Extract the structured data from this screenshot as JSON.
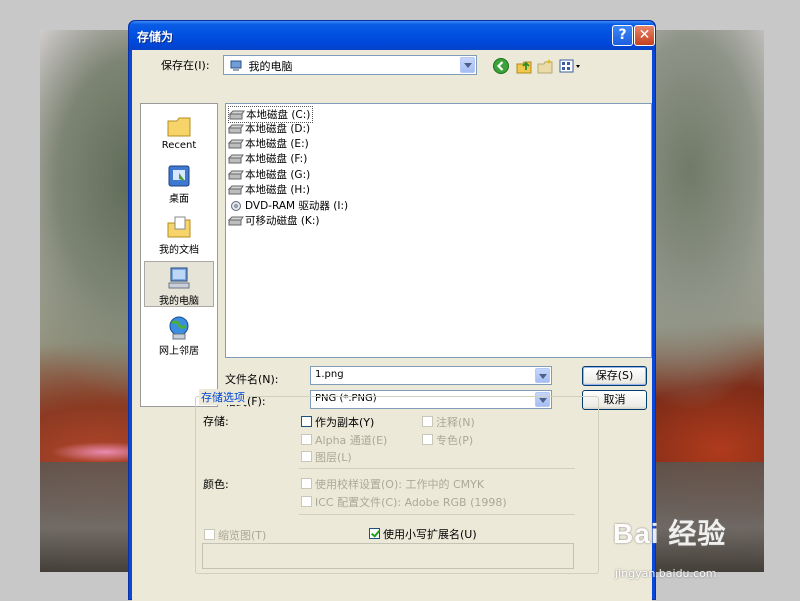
{
  "dialog": {
    "title": "存储为",
    "help_glyph": "?",
    "close_glyph": "✕"
  },
  "save_in": {
    "label": "保存在(I):",
    "value": "我的电脑"
  },
  "places": [
    {
      "label": "Recent",
      "icon": "recent-folder-icon"
    },
    {
      "label": "桌面",
      "icon": "desktop-icon"
    },
    {
      "label": "我的文档",
      "icon": "my-documents-icon"
    },
    {
      "label": "我的电脑",
      "icon": "my-computer-icon",
      "selected": true
    },
    {
      "label": "网上邻居",
      "icon": "network-places-icon"
    }
  ],
  "drives": [
    {
      "label": "本地磁盘 (C:)",
      "icon": "hard-drive-icon"
    },
    {
      "label": "本地磁盘 (D:)",
      "icon": "hard-drive-icon"
    },
    {
      "label": "本地磁盘 (E:)",
      "icon": "hard-drive-icon"
    },
    {
      "label": "本地磁盘 (F:)",
      "icon": "hard-drive-icon"
    },
    {
      "label": "本地磁盘 (G:)",
      "icon": "hard-drive-icon"
    },
    {
      "label": "本地磁盘 (H:)",
      "icon": "hard-drive-icon"
    },
    {
      "label": "DVD-RAM 驱动器 (I:)",
      "icon": "dvd-drive-icon"
    },
    {
      "label": "可移动磁盘 (K:)",
      "icon": "removable-drive-icon"
    }
  ],
  "filename": {
    "label": "文件名(N):",
    "value": "1.png"
  },
  "format": {
    "label": "格式(F):",
    "value": "PNG (*.PNG)"
  },
  "buttons": {
    "save": "保存(S)",
    "cancel": "取消"
  },
  "options": {
    "group_title": "存储选项",
    "storage_label": "存储:",
    "as_copy": "作为副本(Y)",
    "annotations": "注释(N)",
    "alpha": "Alpha 通道(E)",
    "spot": "专色(P)",
    "layers": "图层(L)",
    "color_label": "颜色:",
    "proof": "使用校样设置(O): 工作中的 CMYK",
    "icc": "ICC 配置文件(C): Adobe RGB (1998)",
    "thumbnail": "缩览图(T)",
    "lowercase_ext": "使用小写扩展名(U)",
    "lowercase_ext_checked": true
  },
  "watermark": {
    "logo": "Bai 经验",
    "url": "jingyan.baidu.com"
  }
}
